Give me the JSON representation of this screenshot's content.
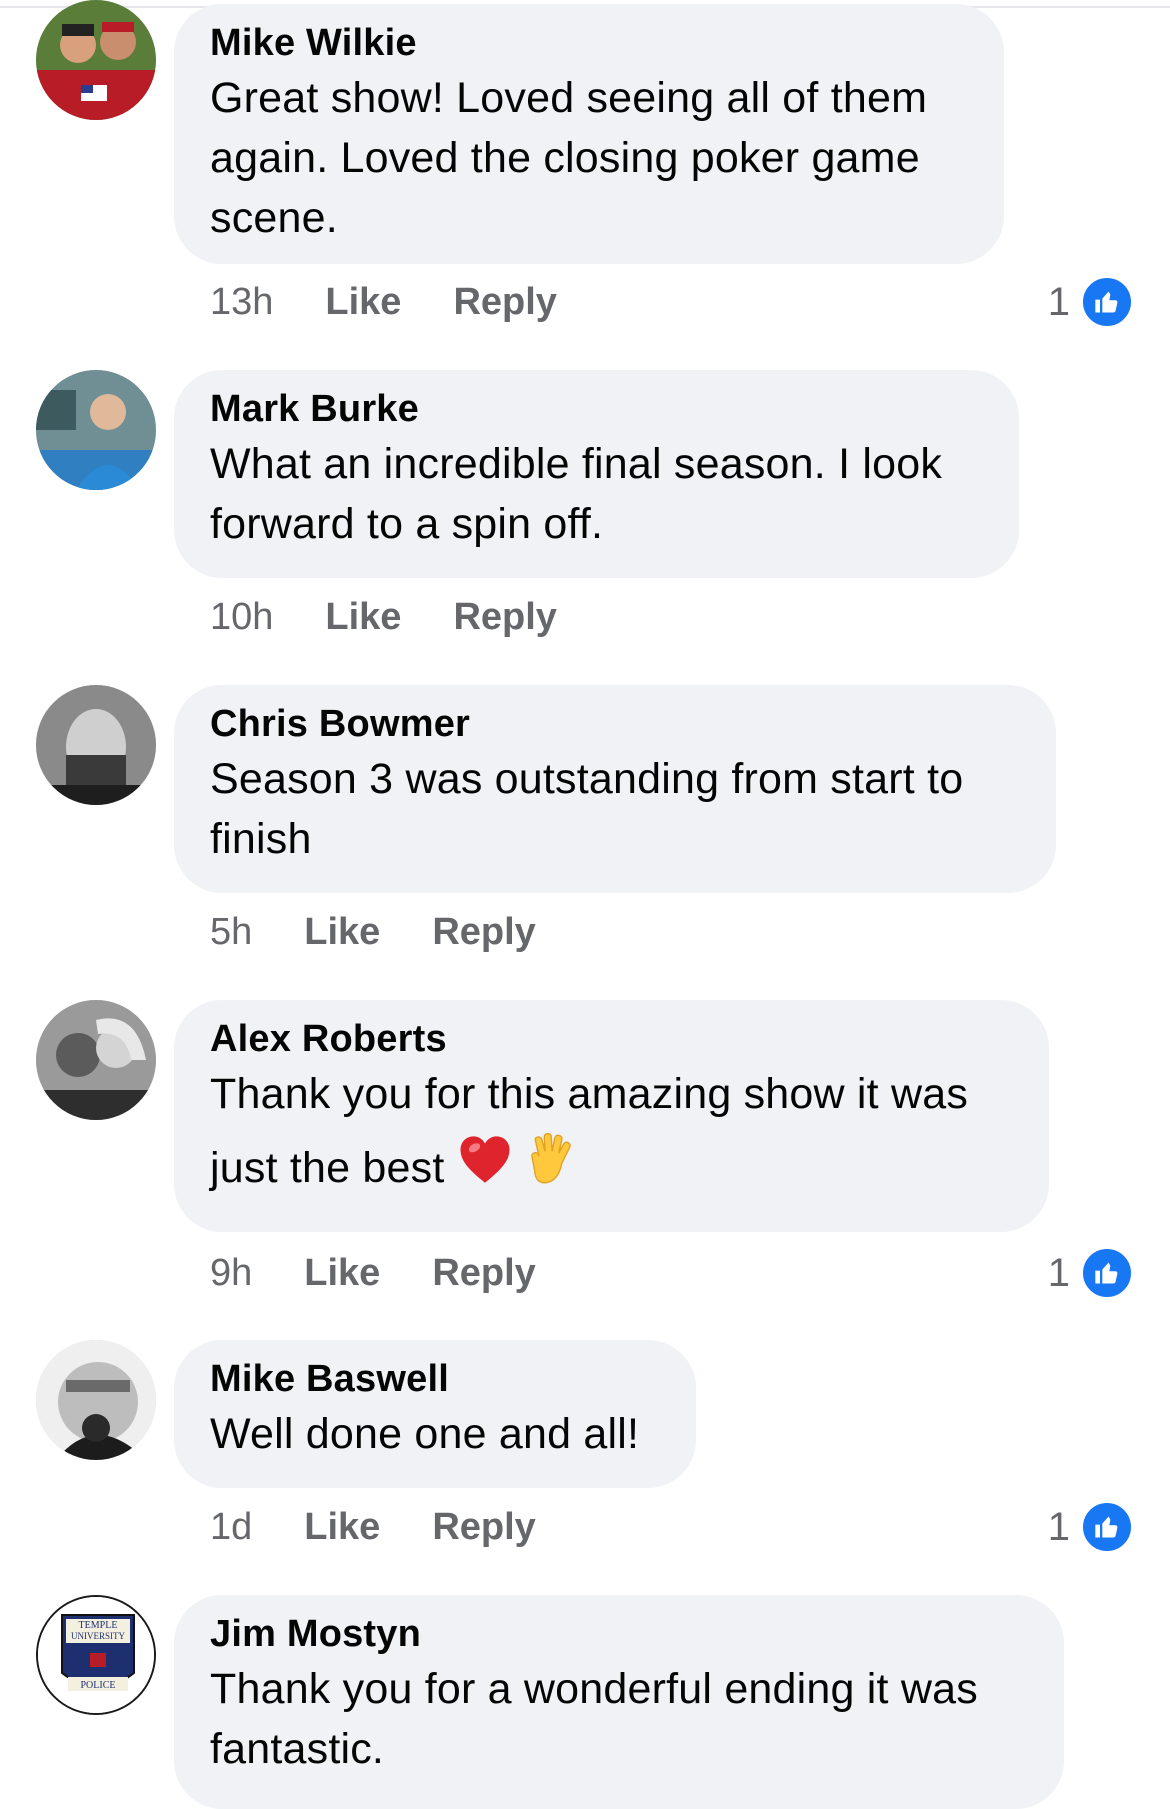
{
  "comments": [
    {
      "author": "Mike Wilkie",
      "text_lines": [
        "Great show! Loved seeing all of them",
        "again. Loved the closing poker game",
        "scene."
      ],
      "time": "13h",
      "like_label": "Like",
      "reply_label": "Reply",
      "reactions": "1"
    },
    {
      "author": "Mark Burke",
      "text_lines": [
        "What an incredible final season. I look",
        "forward to a spin off."
      ],
      "time": "10h",
      "like_label": "Like",
      "reply_label": "Reply"
    },
    {
      "author": "Chris Bowmer",
      "text_lines": [
        "Season 3 was outstanding from start to",
        "finish"
      ],
      "time": "5h",
      "like_label": "Like",
      "reply_label": "Reply"
    },
    {
      "author": "Alex Roberts",
      "text_lines": [
        "Thank you for this amazing show it was",
        "just the best"
      ],
      "time": "9h",
      "like_label": "Like",
      "reply_label": "Reply",
      "reactions": "1"
    },
    {
      "author": "Mike Baswell",
      "text_lines": [
        "Well done one and all!"
      ],
      "time": "1d",
      "like_label": "Like",
      "reply_label": "Reply",
      "reactions": "1"
    },
    {
      "author": "Jim Mostyn",
      "text_lines": [
        "Thank you for a wonderful ending it was",
        "fantastic."
      ]
    }
  ],
  "avatar_badge": {
    "line1": "TEMPLE",
    "line2": "UNIVERSITY",
    "line3": "POLICE"
  },
  "colors": {
    "bubble": "#f0f2f5",
    "meta_text": "#65676b",
    "like_blue": "#1877f2"
  },
  "icons": {
    "like_badge": "thumbs-up-icon",
    "heart_emoji": "red-heart-icon",
    "hand_emoji": "vulcan-salute-icon"
  }
}
